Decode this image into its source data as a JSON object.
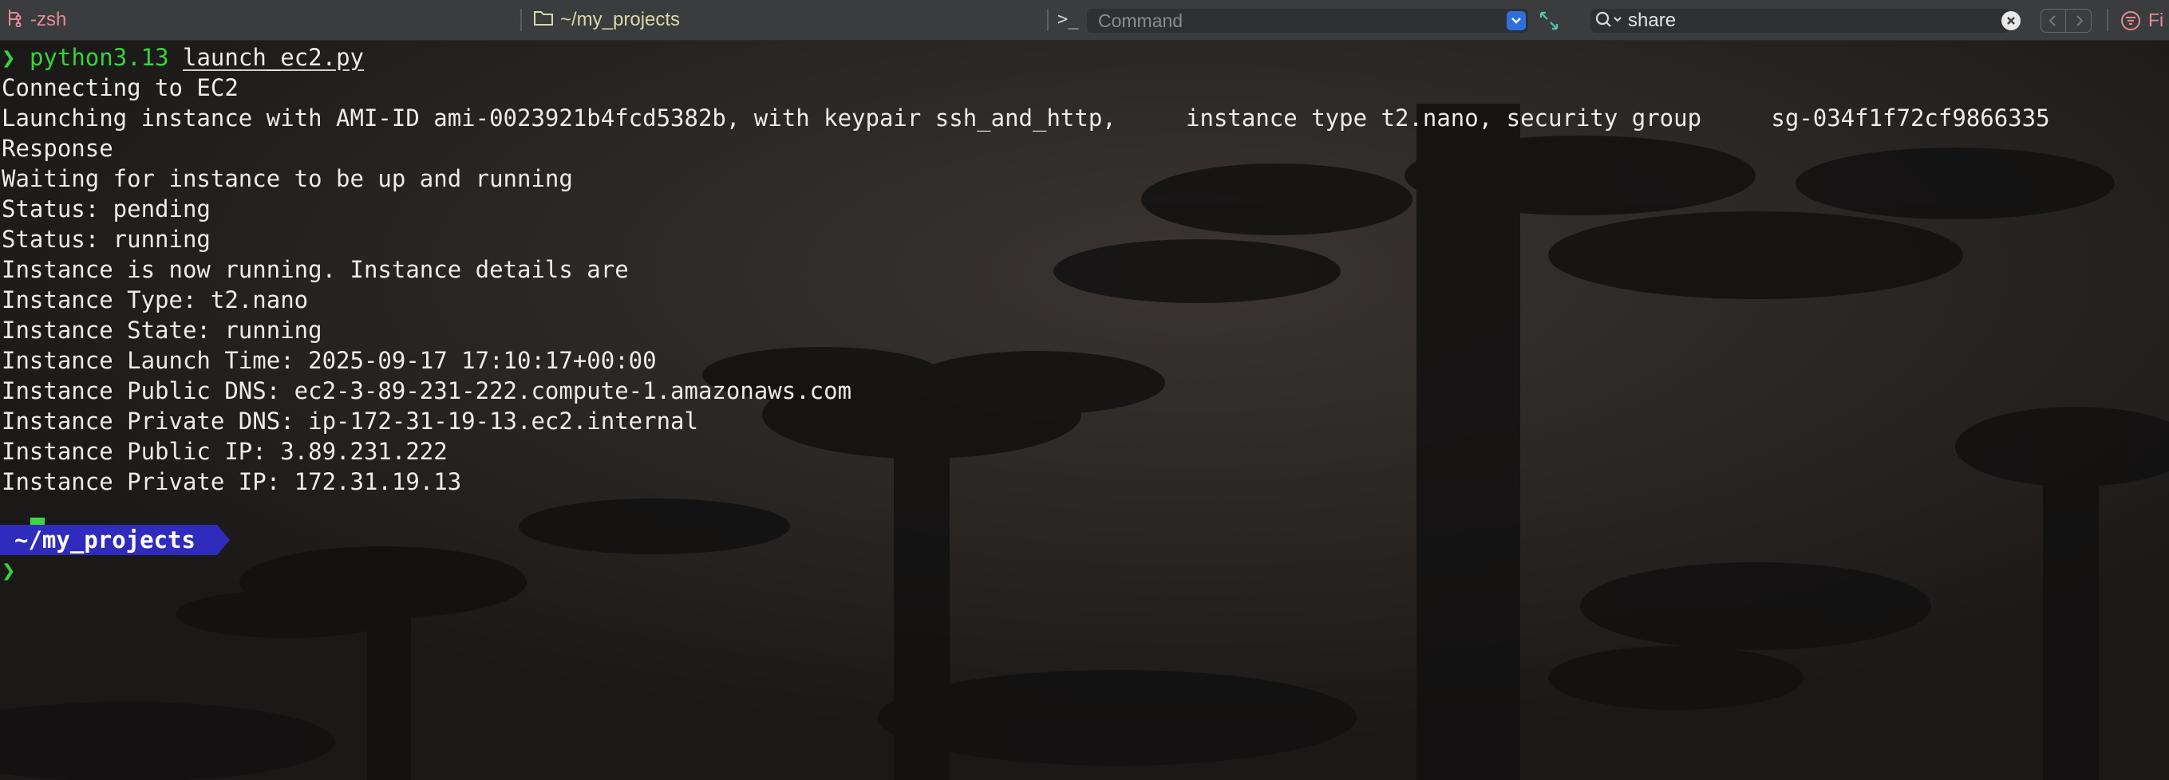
{
  "statusbar": {
    "shell_label": "-zsh",
    "shell_icon": "process-icon",
    "dir_label": "~/my_projects",
    "dir_icon": "folder-icon",
    "command_placeholder": "Command",
    "search_value": "share",
    "filter_label": "Fi"
  },
  "terminal": {
    "prompt_symbol": "❯",
    "command_name": "python3.13",
    "command_arg": "launch_ec2.py",
    "output_lines": [
      "Connecting to EC2",
      "Launching instance with AMI-ID ami-0023921b4fcd5382b, with keypair ssh_and_http,     instance type t2.nano, security group     sg-034f1f72cf9866335",
      "Response",
      "Waiting for instance to be up and running",
      "Status: pending",
      "Status: running",
      "Instance is now running. Instance details are",
      "Instance Type: t2.nano",
      "Instance State: running",
      "Instance Launch Time: 2025-09-17 17:10:17+00:00",
      "Instance Public DNS: ec2-3-89-231-222.compute-1.amazonaws.com",
      "Instance Private DNS: ip-172-31-19-13.ec2.internal",
      "Instance Public IP: 3.89.231.222",
      "Instance Private IP: 172.31.19.13"
    ],
    "powerline_dir": "~/my_projects",
    "powerline_color": "#2e2bbd",
    "cursor_color": "#3fd83c"
  }
}
